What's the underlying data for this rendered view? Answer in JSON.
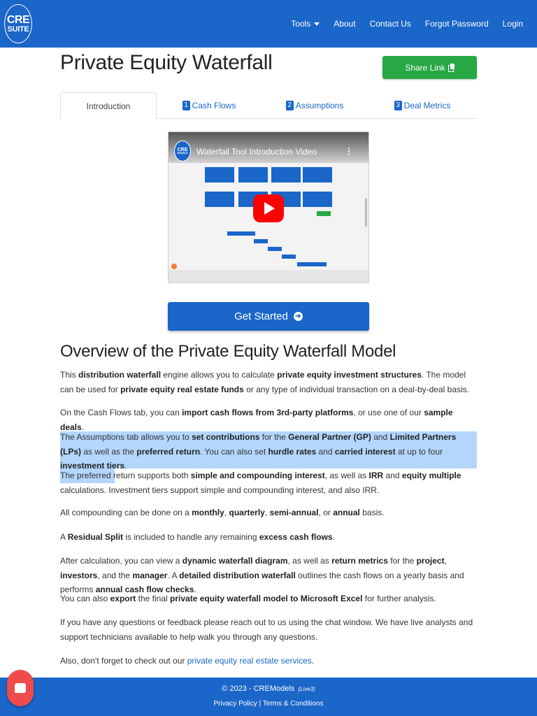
{
  "nav": {
    "logo_line1": "CRE",
    "logo_line2": "SUITE",
    "links": [
      "Tools",
      "About",
      "Contact Us",
      "Forgot Password",
      "Login"
    ]
  },
  "page": {
    "title": "Private Equity Waterfall",
    "share_label": "Share Link"
  },
  "tabs": [
    {
      "num": "",
      "label": "Introduction"
    },
    {
      "num": "1",
      "label": "Cash Flows"
    },
    {
      "num": "2",
      "label": "Assumptions"
    },
    {
      "num": "3",
      "label": "Deal Metrics"
    }
  ],
  "video": {
    "title": "Waterfall Tool Introduction Video",
    "logo_line1": "CRE",
    "logo_line2": "MODELS"
  },
  "get_started_label": "Get Started",
  "overview": {
    "title": "Overview of the Private Equity Waterfall Model"
  },
  "paragraphs": [
    [
      {
        "t": "This "
      },
      {
        "b": "distribution waterfall"
      },
      {
        "t": " engine allows you to calculate "
      },
      {
        "b": "private equity investment structures"
      },
      {
        "t": ". The model can be used for "
      },
      {
        "b": "private equity real estate funds"
      },
      {
        "t": " or any type of individual transaction on a deal-by-deal basis."
      }
    ],
    [
      {
        "t": "On the Cash Flows tab, you can "
      },
      {
        "b": "import cash flows from 3rd-party platforms"
      },
      {
        "t": ", or use one of our "
      },
      {
        "b": "sample deals"
      },
      {
        "t": "."
      }
    ],
    [
      {
        "t": "The Assumptions tab allows you to "
      },
      {
        "b": "set contributions"
      },
      {
        "t": " for the "
      },
      {
        "b": "General Partner (GP)"
      },
      {
        "t": " and "
      },
      {
        "b": "Limited Partners (LPs)"
      },
      {
        "t": " as well as the "
      },
      {
        "b": "preferred return"
      },
      {
        "t": ". You can also set "
      },
      {
        "b": "hurdle rates"
      },
      {
        "t": " and "
      },
      {
        "b": "carried interest"
      },
      {
        "t": " at up to four "
      },
      {
        "b": "investment tiers"
      },
      {
        "t": "."
      }
    ],
    [
      {
        "t": "The preferred return supports both "
      },
      {
        "b": "simple and compounding interest"
      },
      {
        "t": ", as well as "
      },
      {
        "b": "IRR"
      },
      {
        "t": " and "
      },
      {
        "b": "equity multiple"
      },
      {
        "t": " calculations. Investment tiers support simple and compounding interest, and also IRR."
      }
    ],
    [
      {
        "t": "All compounding can be done on a "
      },
      {
        "b": "monthly"
      },
      {
        "t": ", "
      },
      {
        "b": "quarterly"
      },
      {
        "t": ", "
      },
      {
        "b": "semi-annual"
      },
      {
        "t": ", or "
      },
      {
        "b": "annual"
      },
      {
        "t": " basis."
      }
    ],
    [
      {
        "t": "A "
      },
      {
        "b": "Residual Split"
      },
      {
        "t": " is included to handle any remaining "
      },
      {
        "b": "excess cash flows"
      },
      {
        "t": "."
      }
    ],
    [
      {
        "t": "After calculation, you can view a "
      },
      {
        "b": "dynamic waterfall diagram"
      },
      {
        "t": ", as well as "
      },
      {
        "b": "return metrics"
      },
      {
        "t": " for the "
      },
      {
        "b": "project"
      },
      {
        "t": ", "
      },
      {
        "b": "investors"
      },
      {
        "t": ", and the "
      },
      {
        "b": "manager"
      },
      {
        "t": ". A "
      },
      {
        "b": "detailed distribution waterfall"
      },
      {
        "t": " outlines the cash flows on a yearly basis and performs "
      },
      {
        "b": "annual cash flow checks"
      },
      {
        "t": "."
      }
    ],
    [
      {
        "t": "You can also "
      },
      {
        "b": "export"
      },
      {
        "t": " the final "
      },
      {
        "b": "private equity waterfall model to Microsoft Excel"
      },
      {
        "t": " for further analysis."
      }
    ],
    [
      {
        "t": "If you have any questions or feedback please reach out to us using the chat window. We have live analysts and support technicians available to help walk you through any questions."
      }
    ],
    [
      {
        "t": "Also, don't forget to check out our "
      },
      {
        "a": "private equity real estate services"
      },
      {
        "t": "."
      }
    ]
  ],
  "footer": {
    "copyright": "© 2023 - CREModels",
    "version": "(Live3)",
    "privacy": "Privacy Policy",
    "separator": "|",
    "terms": "Terms & Conditions"
  },
  "colors": {
    "brand_blue": "#1a66c9",
    "share_green": "#28a745",
    "highlight": "#b4d6fc",
    "chat_red": "#ef4b4b"
  }
}
